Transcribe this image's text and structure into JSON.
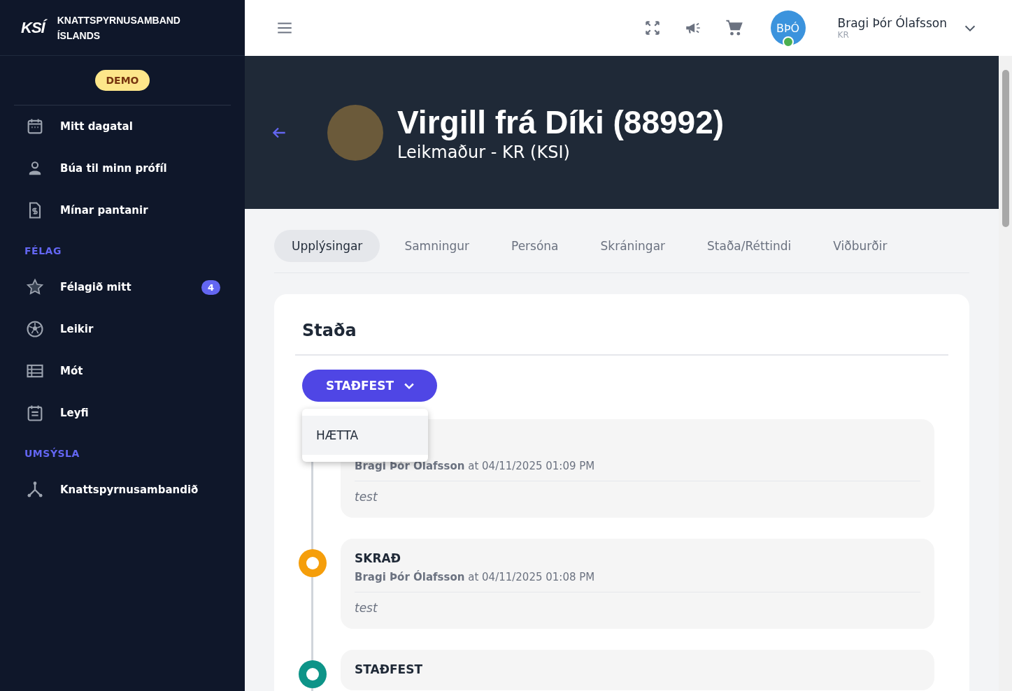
{
  "sidebar": {
    "logo": "KSÍ",
    "org_name": "KNATTSPYRNUSAMBAND ÍSLANDS",
    "env_badge": "DEMO",
    "sections": [
      {
        "items": [
          {
            "label": "Mitt dagatal",
            "selected": false
          },
          {
            "label": "Búa til minn prófíl",
            "selected": false
          },
          {
            "label": "Mínar pantanir",
            "selected": false
          }
        ]
      },
      {
        "heading": "FÉLAG",
        "items": [
          {
            "label": "Félagið mitt",
            "badge": "4",
            "selected": false
          },
          {
            "label": "Leikir",
            "selected": false
          },
          {
            "label": "Mót",
            "selected": false
          },
          {
            "label": "Leyfi",
            "selected": false
          }
        ]
      },
      {
        "heading": "UMSÝSLA",
        "items": [
          {
            "label": "Knattspyrnusambandið",
            "selected": false
          }
        ]
      }
    ]
  },
  "topbar": {
    "user": {
      "initials": "BÞÓ",
      "online": true,
      "name": "Bragi Þór Ólafsson",
      "club": "KR"
    }
  },
  "hero": {
    "title": "Virgill frá Díki (88992)",
    "subtitle": "Leikmaður - KR (KSI)"
  },
  "tabs": [
    {
      "label": "Upplýsingar",
      "selected": true
    },
    {
      "label": "Samningur",
      "selected": false
    },
    {
      "label": "Persóna",
      "selected": false
    },
    {
      "label": "Skráningar",
      "selected": false
    },
    {
      "label": "Staða/Réttindi",
      "selected": false
    },
    {
      "label": "Viðburðir",
      "selected": false
    }
  ],
  "status_card": {
    "title": "Staða",
    "status_button": "STAÐFEST",
    "menu": {
      "expanded": true,
      "options": [
        "HÆTTA"
      ]
    },
    "entries": [
      {
        "author": "Bragi Þór Ólafsson",
        "time": "at 04/11/2025 01:09 PM",
        "note": "test"
      },
      {
        "status": "SKRAÐ",
        "color": "#f59e0b",
        "author": "Bragi Þór Ólafsson",
        "time": "at 04/11/2025 01:08 PM",
        "note": "test"
      },
      {
        "status": "STAÐFEST",
        "color": "#0d9488"
      }
    ]
  }
}
